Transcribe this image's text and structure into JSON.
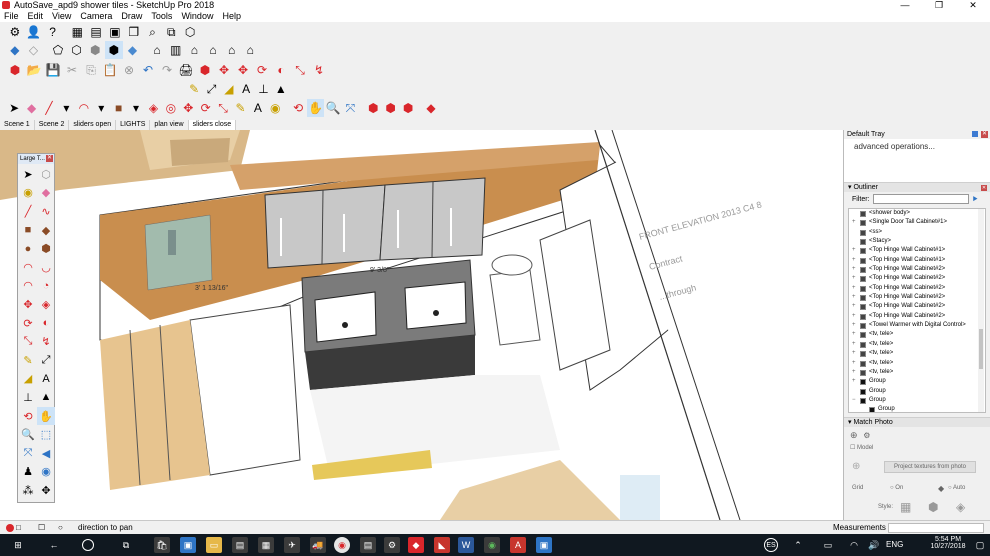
{
  "window": {
    "title": "AutoSave_apd9 shower tiles - SketchUp Pro 2018",
    "controls": [
      "—",
      "❐",
      "✕"
    ]
  },
  "menu": [
    "File",
    "Edit",
    "View",
    "Camera",
    "Draw",
    "Tools",
    "Window",
    "Help"
  ],
  "scenes": [
    "Scene 1",
    "Scene 2",
    "sliders open",
    "LIGHTS",
    "plan view",
    "sliders close"
  ],
  "active_scene": "sliders close",
  "largetool": {
    "title": "Large T..."
  },
  "drawing": {
    "dimensions": [
      "9' 3/8\"",
      "3' 1 13/16\""
    ],
    "plan_text": [
      "FRONT ELEVATION 2013 C4 8",
      "Contract",
      "...through"
    ]
  },
  "tray": {
    "title": "Default Tray",
    "instructor_text": "advanced operations...",
    "outliner": {
      "header": "Outliner",
      "filter_label": "Filter:",
      "filter_value": "",
      "items": [
        {
          "label": "<shower body>",
          "type": "component",
          "expandable": false
        },
        {
          "label": "<Single Door Tall Cabinet#1>",
          "type": "component",
          "expandable": true
        },
        {
          "label": "<ss>",
          "type": "component",
          "expandable": false
        },
        {
          "label": "<Stacy>",
          "type": "component",
          "expandable": false
        },
        {
          "label": "<Top Hinge Wall Cabinet#1>",
          "type": "component",
          "expandable": true
        },
        {
          "label": "<Top Hinge Wall Cabinet#1>",
          "type": "component",
          "expandable": true
        },
        {
          "label": "<Top Hinge Wall Cabinet#2>",
          "type": "component",
          "expandable": true
        },
        {
          "label": "<Top Hinge Wall Cabinet#2>",
          "type": "component",
          "expandable": true
        },
        {
          "label": "<Top Hinge Wall Cabinet#2>",
          "type": "component",
          "expandable": true
        },
        {
          "label": "<Top Hinge Wall Cabinet#2>",
          "type": "component",
          "expandable": true
        },
        {
          "label": "<Top Hinge Wall Cabinet#2>",
          "type": "component",
          "expandable": true
        },
        {
          "label": "<Top Hinge Wall Cabinet#2>",
          "type": "component",
          "expandable": true
        },
        {
          "label": "<Towel Warmer with Digital Control>",
          "type": "component",
          "expandable": true
        },
        {
          "label": "<tv, tele>",
          "type": "component",
          "expandable": true
        },
        {
          "label": "<tv, tele>",
          "type": "component",
          "expandable": true
        },
        {
          "label": "<tv, tele>",
          "type": "component",
          "expandable": true
        },
        {
          "label": "<tv, tele>",
          "type": "component",
          "expandable": true
        },
        {
          "label": "<tv, tele>",
          "type": "component",
          "expandable": true
        },
        {
          "label": "Group",
          "type": "group",
          "expandable": true
        },
        {
          "label": "Group",
          "type": "group",
          "expandable": false
        },
        {
          "label": "Group",
          "type": "group",
          "expandable": true,
          "expanded": true
        },
        {
          "label": "Group",
          "type": "group",
          "expandable": false,
          "indent": true
        }
      ]
    },
    "match_photo": {
      "header": "Match Photo",
      "model_label": "Model",
      "project_button": "Project textures from photo",
      "grid_label": "Grid",
      "grid_on": "On",
      "grid_auto": "Auto",
      "style_label": "Style:"
    }
  },
  "status": {
    "message": "direction to pan",
    "measurements_label": "Measurements"
  },
  "taskbar": {
    "lang": "ENG",
    "time": "5:54 PM",
    "date": "10/27/2018"
  },
  "colors": {
    "accent": "#d9262b",
    "taskbar": "#101820",
    "highlight_tool": "#cde3f7"
  }
}
